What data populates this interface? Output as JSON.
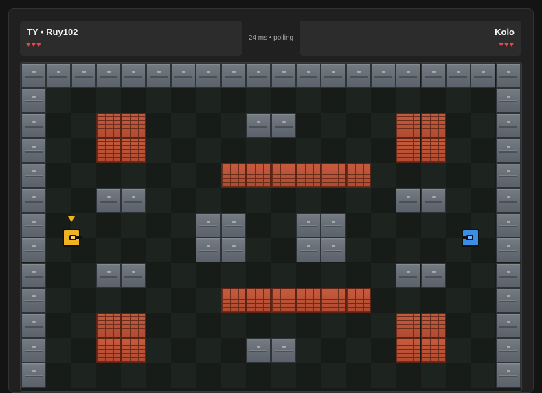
{
  "player_left": {
    "name": "TY • Ruy102",
    "hearts": "♥♥♥",
    "lives": 3
  },
  "player_right": {
    "name": "Kolo",
    "hearts": "♥♥♥",
    "lives": 3
  },
  "status": "24 ms • polling",
  "colors": {
    "heart": "#e5484d",
    "player_left_tank": "#f0b324",
    "player_right_tank": "#3a8ee6"
  },
  "map": {
    "legend": {
      "S": "steel-wall",
      "B": "brick-wall",
      ".": "floor",
      "Y": "yellow-tank (player)",
      "K": "blue-tank (opponent)"
    },
    "rows": [
      "SSSSSSSSSSSSSSSSSSSS",
      "S..................S",
      "S..BB....SS....BB..S",
      "S..BB..........BB..S",
      "S.......BBBBBB.....S",
      "S..SS..........SS..S",
      "S.Y....SS..SS....K.S",
      "S......SS..SS......S",
      "S..SS..........SS..S",
      "S.......BBBBBB.....S",
      "S..BB..........BB..S",
      "S..BB....SS....BB..S",
      "S..................S"
    ]
  }
}
